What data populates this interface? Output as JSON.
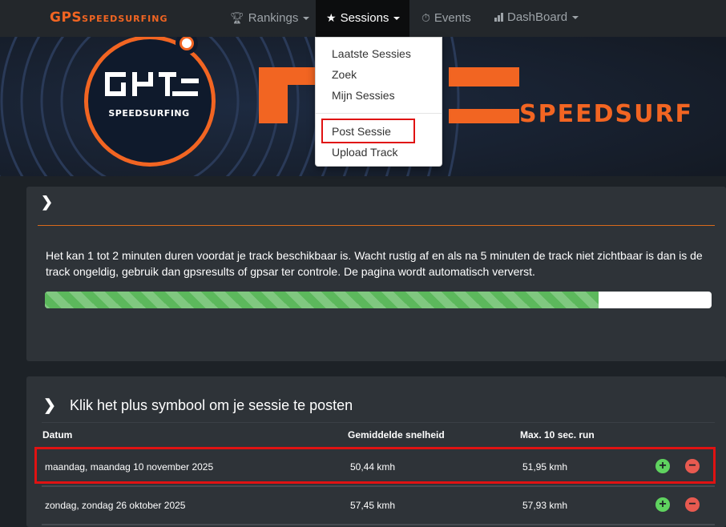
{
  "brand": {
    "name_prefix": "GPS",
    "name_suffix": "SPEEDSURFING"
  },
  "nav": {
    "rankings": "Rankings",
    "sessions": "Sessions",
    "events": "Events",
    "dashboard": "DashBoard"
  },
  "hero": {
    "logo_text": "SPEEDSURFING",
    "banner_text": "SPEEDSURF"
  },
  "dropdown": {
    "items": [
      "Laatste Sessies",
      "Zoek",
      "Mijn Sessies"
    ],
    "items2": [
      "Post Sessie",
      "Upload Track"
    ],
    "highlighted": "Post Sessie"
  },
  "info": {
    "message": "Het kan 1 tot 2 minuten duren voordat je track beschikbaar is. Wacht rustig af en als na 5 minuten de track niet zichtbaar is dan is de track ongeldig, gebruik dan gpsresults of gpsar ter controle. De pagina wordt automatisch ververst.",
    "progress": 0.83
  },
  "sessions": {
    "title": "Klik het plus symbool om je sessie te posten",
    "columns": [
      "Datum",
      "Gemiddelde snelheid",
      "Max. 10 sec. run"
    ],
    "rows": [
      {
        "date": "maandag, maandag 10 november 2025",
        "avg": "50,44 kmh",
        "max": "51,95 kmh"
      },
      {
        "date": "zondag, zondag 26 oktober 2025",
        "avg": "57,45 kmh",
        "max": "57,93 kmh"
      }
    ]
  },
  "colors": {
    "accent": "#f26522",
    "navbar": "#23272b",
    "panel": "#2e3338",
    "highlight": "#e01212",
    "progress": "#5cb85c"
  }
}
